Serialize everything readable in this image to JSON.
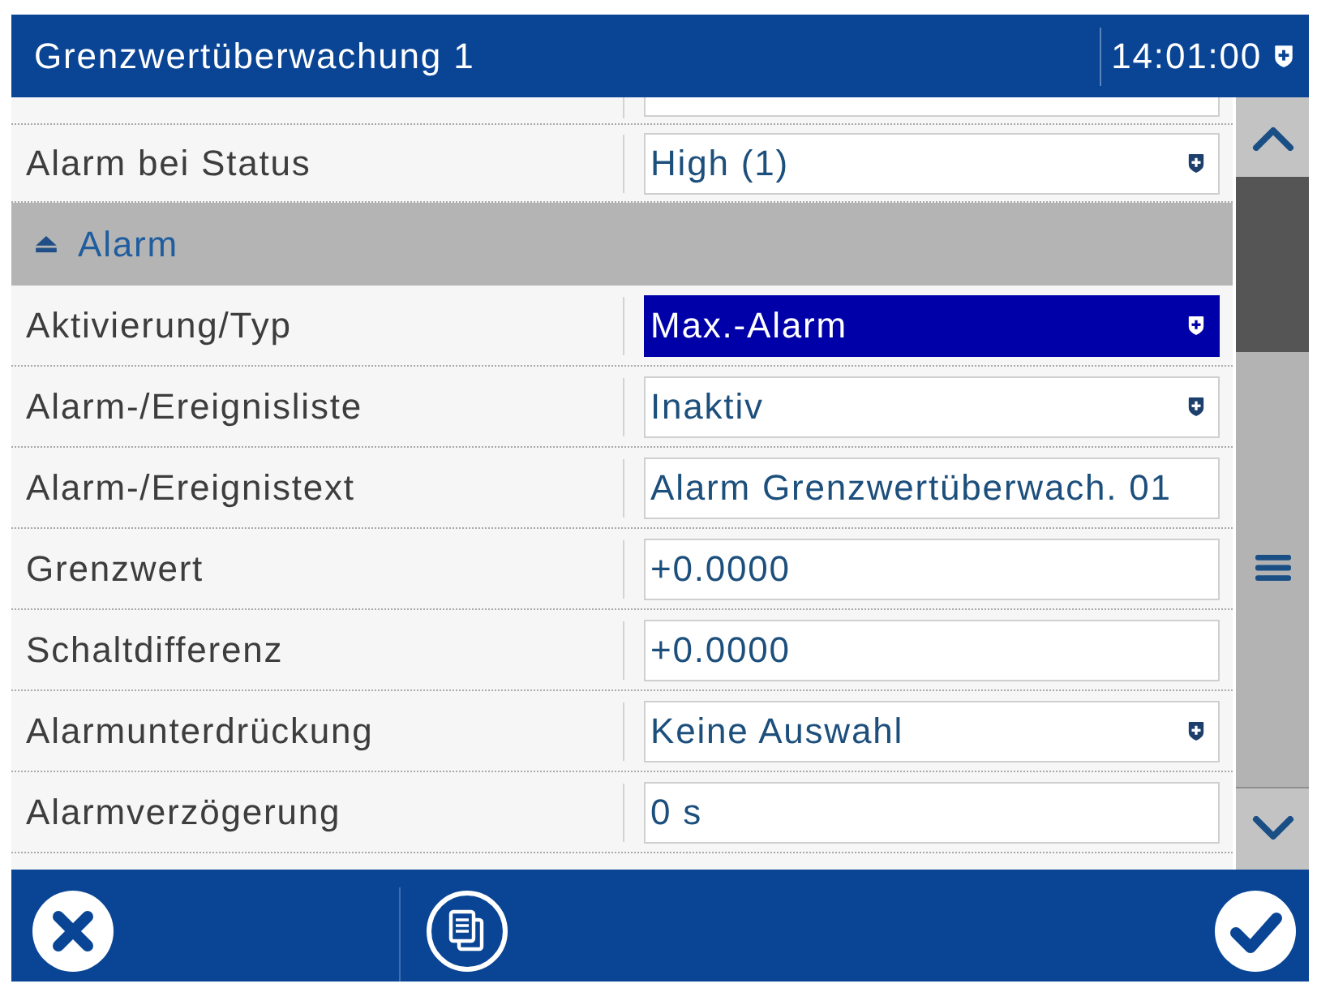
{
  "title_bar": {
    "title": "Grenzwertüberwachung 1",
    "time": "14:01:00"
  },
  "settings": [
    {
      "kind": "clipped",
      "selected": false
    },
    {
      "kind": "dropdown",
      "label": "Alarm bei Status",
      "value": "High (1)",
      "selected": false
    },
    {
      "kind": "section",
      "title": "Alarm",
      "expanded": true
    },
    {
      "kind": "dropdown",
      "label": "Aktivierung/Typ",
      "value": "Max.-Alarm",
      "selected": true
    },
    {
      "kind": "dropdown",
      "label": "Alarm-/Ereignisliste",
      "value": "Inaktiv",
      "selected": false
    },
    {
      "kind": "text",
      "label": "Alarm-/Ereignistext",
      "value": "Alarm Grenzwertüberwach. 01",
      "selected": false
    },
    {
      "kind": "text",
      "label": "Grenzwert",
      "value": "+0.0000",
      "selected": false
    },
    {
      "kind": "text",
      "label": "Schaltdifferenz",
      "value": "+0.0000",
      "selected": false
    },
    {
      "kind": "dropdown",
      "label": "Alarmunterdrückung",
      "value": "Keine Auswahl",
      "selected": false
    },
    {
      "kind": "text",
      "label": "Alarmverzögerung",
      "value": "0 s",
      "selected": false
    }
  ]
}
